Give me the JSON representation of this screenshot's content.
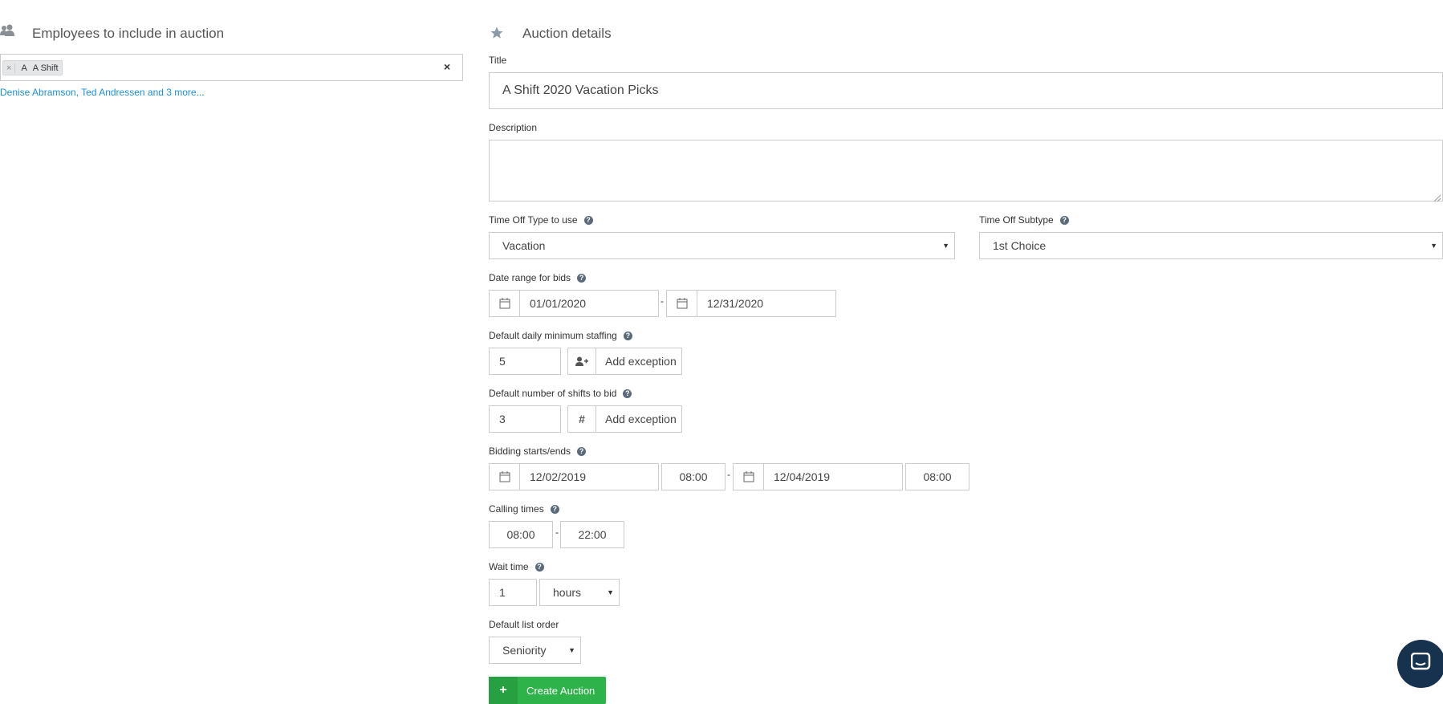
{
  "left": {
    "title": "Employees to include in auction",
    "tags": [
      {
        "remove": "×",
        "initial": "A",
        "label": "A Shift"
      }
    ],
    "clear": "×",
    "employees_link": "Denise Abramson, Ted Andressen and 3 more..."
  },
  "right": {
    "title": "Auction details",
    "title_label": "Title",
    "title_value": "A Shift 2020 Vacation Picks",
    "description_label": "Description",
    "description_value": "",
    "time_off_type_label": "Time Off Type to use",
    "time_off_type_value": "Vacation",
    "time_off_subtype_label": "Time Off Subtype",
    "time_off_subtype_value": "1st Choice",
    "date_range_label": "Date range for bids",
    "date_range_start": "01/01/2020",
    "date_range_end": "12/31/2020",
    "min_staffing_label": "Default daily minimum staffing",
    "min_staffing_value": "5",
    "add_exception_label": "Add exception",
    "shifts_to_bid_label": "Default number of shifts to bid",
    "shifts_to_bid_value": "3",
    "bidding_label": "Bidding starts/ends",
    "bidding_start_date": "12/02/2019",
    "bidding_start_time": "08:00",
    "bidding_end_date": "12/04/2019",
    "bidding_end_time": "08:00",
    "calling_label": "Calling times",
    "calling_start": "08:00",
    "calling_end": "22:00",
    "wait_label": "Wait time",
    "wait_value": "1",
    "wait_unit": "hours",
    "list_order_label": "Default list order",
    "list_order_value": "Seniority",
    "create_button": "Create Auction",
    "dash": "-",
    "help_glyph": "?",
    "hash_glyph": "#",
    "plus_glyph": "+"
  },
  "colors": {
    "accent_green": "#2db34a",
    "link_blue": "#1a8fd9",
    "chat_bubble": "#16324f"
  }
}
